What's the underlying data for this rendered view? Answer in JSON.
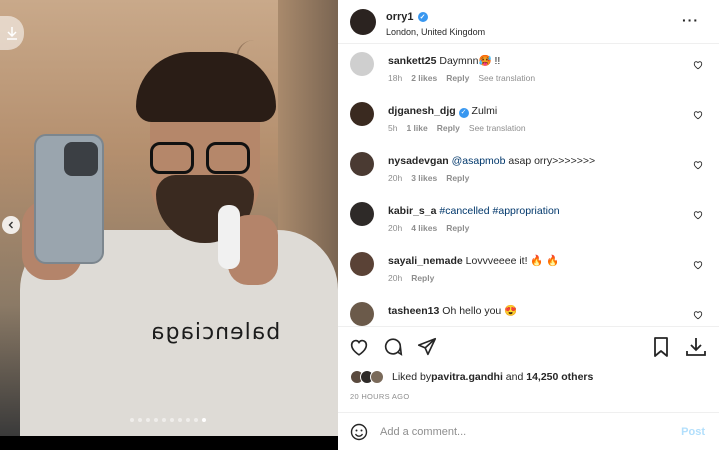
{
  "post": {
    "username": "orry1",
    "location": "London, United Kingdom",
    "shirt_text": "balenciaga",
    "carousel_total": 10,
    "carousel_active": 10
  },
  "comments": [
    {
      "user": "sankett25",
      "text": "Daymnn🥵 !!",
      "verified": false,
      "time": "18h",
      "likes": "2 likes",
      "reply": "Reply",
      "translate": "See translation",
      "avatar_color": "#cfcfcf"
    },
    {
      "user": "djganesh_djg",
      "text": "Zulmi",
      "verified": true,
      "time": "5h",
      "likes": "1 like",
      "reply": "Reply",
      "translate": "See translation",
      "avatar_color": "#3a2a20"
    },
    {
      "user": "nysadevgan",
      "mention": "@asapmob",
      "text": " asap orry>>>>>>>",
      "verified": false,
      "time": "20h",
      "likes": "3 likes",
      "reply": "Reply",
      "translate": "",
      "avatar_color": "#4a3a32"
    },
    {
      "user": "kabir_s_a",
      "mention": "#cancelled #appropriation",
      "text": "",
      "verified": false,
      "time": "20h",
      "likes": "4 likes",
      "reply": "Reply",
      "translate": "",
      "avatar_color": "#2e2a28"
    },
    {
      "user": "sayali_nemade",
      "text": "Lovvveeee it! 🔥 🔥",
      "verified": false,
      "time": "20h",
      "likes": "",
      "reply": "Reply",
      "translate": "",
      "avatar_color": "#5a4236"
    },
    {
      "user": "tasheen13",
      "text": "Oh hello you 😍",
      "verified": false,
      "time": "",
      "likes": "",
      "reply": "",
      "translate": "",
      "avatar_color": "#6b5a4a"
    }
  ],
  "likes": {
    "prefix": "Liked by ",
    "user": "pavitra.gandhi",
    "middle": " and ",
    "count": "14,250 others"
  },
  "timestamp": "20 HOURS AGO",
  "composer": {
    "placeholder": "Add a comment...",
    "post_label": "Post"
  },
  "icons": {
    "more": "more-horizontal-icon",
    "heart": "heart-icon",
    "comment": "comment-icon",
    "share": "share-icon",
    "save": "bookmark-icon",
    "download": "download-icon",
    "emoji": "emoji-icon"
  },
  "colors": {
    "verified": "#3897f0",
    "mention": "#00376b",
    "post_disabled": "#b2dffc",
    "meta": "#8e8e8e"
  }
}
